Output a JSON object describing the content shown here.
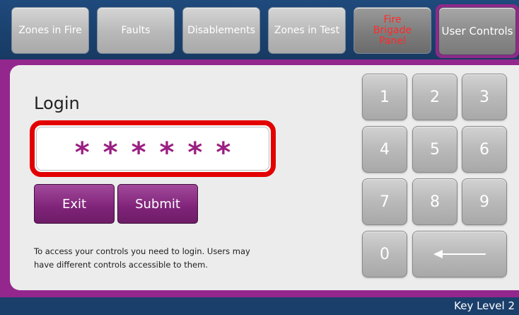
{
  "nav": {
    "tabs": [
      {
        "label": "Zones in Fire"
      },
      {
        "label": "Faults"
      },
      {
        "label": "Disablements"
      },
      {
        "label": "Zones in Test"
      },
      {
        "label": "Fire\nBrigade\nPanel"
      },
      {
        "label": "User Controls"
      }
    ],
    "active_tab": "User Controls",
    "fire_tab_color": "#ff2a2a"
  },
  "login": {
    "title": "Login",
    "password_masked": "******",
    "exit_label": "Exit",
    "submit_label": "Submit",
    "help_text": "To access your controls you need to login. Users may have different controls accessible to them."
  },
  "keypad": {
    "keys": [
      "1",
      "2",
      "3",
      "4",
      "5",
      "6",
      "7",
      "8",
      "9",
      "0"
    ],
    "backspace_icon": "left-arrow-icon"
  },
  "status": {
    "key_level": "Key Level 2"
  },
  "colors": {
    "accent": "#94278e",
    "header_bg": "#1b3f6b",
    "highlight_border": "#e20000",
    "mask_color": "#9a1f82"
  }
}
